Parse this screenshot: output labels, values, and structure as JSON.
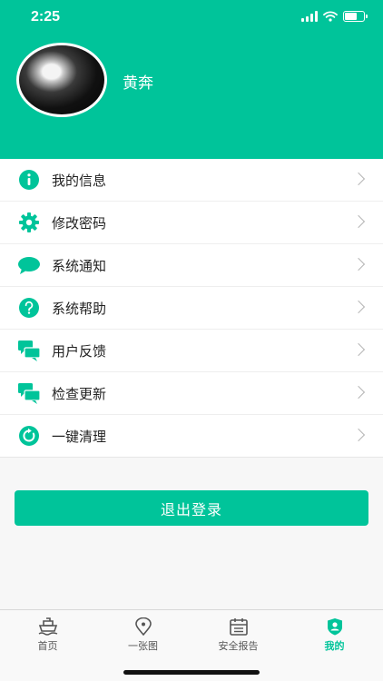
{
  "status": {
    "time": "2:25"
  },
  "profile": {
    "name": "黄奔"
  },
  "menu": [
    {
      "label": "我的信息",
      "icon": "info-icon"
    },
    {
      "label": "修改密码",
      "icon": "gear-icon"
    },
    {
      "label": "系统通知",
      "icon": "chat-bubble-icon"
    },
    {
      "label": "系统帮助",
      "icon": "help-icon"
    },
    {
      "label": "用户反馈",
      "icon": "feedback-icon"
    },
    {
      "label": "检查更新",
      "icon": "update-icon"
    },
    {
      "label": "一键清理",
      "icon": "refresh-icon"
    }
  ],
  "logout_label": "退出登录",
  "tabs": [
    {
      "label": "首页",
      "icon": "ship-icon",
      "active": false
    },
    {
      "label": "一张图",
      "icon": "map-pin-icon",
      "active": false
    },
    {
      "label": "安全报告",
      "icon": "calendar-icon",
      "active": false
    },
    {
      "label": "我的",
      "icon": "user-shield-icon",
      "active": true
    }
  ],
  "colors": {
    "accent": "#00c49a",
    "background": "#f7f7f7"
  }
}
